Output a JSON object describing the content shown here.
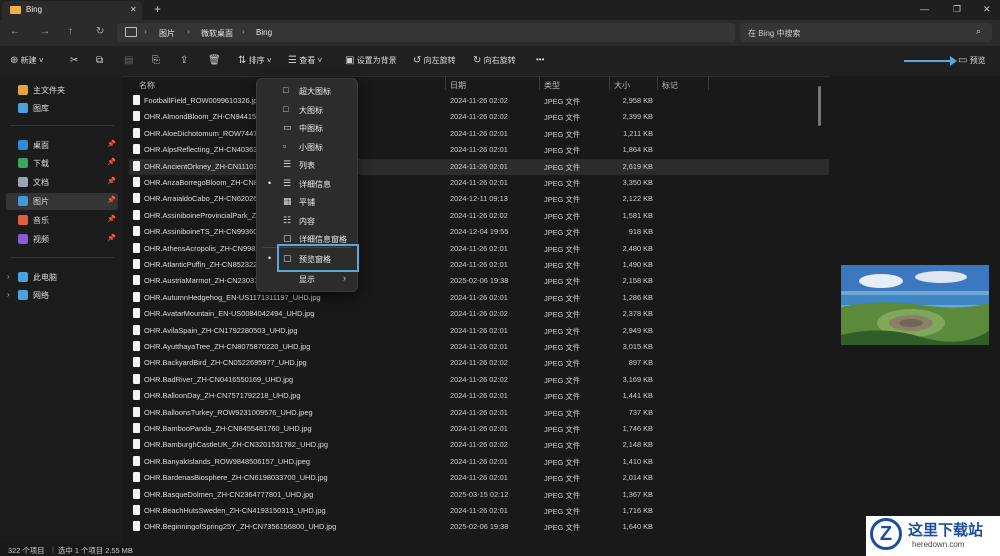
{
  "titlebar": {
    "tab_title": "Bing",
    "new_tab": "+",
    "min": "—",
    "max": "❐",
    "close": "✕"
  },
  "address": {
    "crumbs": [
      "图片",
      "微软桌面",
      "Bing"
    ],
    "search_placeholder": "在 Bing 中搜索"
  },
  "toolbar": {
    "new_label": "新建",
    "sort_label": "排序",
    "view_label": "查看",
    "set_bg_label": "设置为背景",
    "rotate_left_label": "向左旋转",
    "rotate_right_label": "向右旋转",
    "more_label": "•••",
    "preview_label": "预览"
  },
  "sidebar": {
    "items": [
      {
        "label": "主文件夹",
        "color": "#e8a33d"
      },
      {
        "label": "图库",
        "color": "#4aa3df"
      },
      {
        "label": "桌面",
        "color": "#2f88d8",
        "pin": "📌"
      },
      {
        "label": "下载",
        "color": "#3aa55d",
        "pin": "📌"
      },
      {
        "label": "文档",
        "color": "#9aa4b1",
        "pin": "📌"
      },
      {
        "label": "图片",
        "color": "#3e9ad8",
        "pin": "📌"
      },
      {
        "label": "音乐",
        "color": "#e0603a",
        "pin": "📌"
      },
      {
        "label": "视频",
        "color": "#8a5ad8",
        "pin": "📌"
      },
      {
        "label": "此电脑",
        "color": "#4aa3df"
      },
      {
        "label": "网络",
        "color": "#4aa3df"
      }
    ]
  },
  "columns": {
    "name": "名称",
    "date": "日期",
    "type": "类型",
    "size": "大小",
    "tag": "标记"
  },
  "files": [
    {
      "name": "FootballField_ROW0099610326.jpg",
      "date": "2024-11-26 02:02",
      "type": "JPEG 文件",
      "size": "2,958 KB"
    },
    {
      "name": "OHR.AlmondBloom_ZH-CN9441554",
      "date": "2024-11-26 02:02",
      "type": "JPEG 文件",
      "size": "2,399 KB"
    },
    {
      "name": "OHR.AloeDichotomum_ROW7447",
      "date": "2024-11-26 02:01",
      "type": "JPEG 文件",
      "size": "1,211 KB"
    },
    {
      "name": "OHR.AlpsReflecting_ZH-CN403632",
      "date": "2024-11-26 02:01",
      "type": "JPEG 文件",
      "size": "1,864 KB"
    },
    {
      "name": "OHR.AncientOrkney_ZH-CN11103",
      "date": "2024-11-26 02:01",
      "type": "JPEG 文件",
      "size": "2,619 KB"
    },
    {
      "name": "OHR.AnzaBorregoBloom_ZH-CN8",
      "date": "2024-11-26 02:01",
      "type": "JPEG 文件",
      "size": "3,350 KB"
    },
    {
      "name": "OHR.ArraialdoCabo_ZH-CN62026",
      "date": "2024-12-11 09:13",
      "type": "JPEG 文件",
      "size": "2,122 KB"
    },
    {
      "name": "OHR.AssiniboineProvincialPark_ZH",
      "date": "2024-11-26 02:02",
      "type": "JPEG 文件",
      "size": "1,581 KB"
    },
    {
      "name": "OHR.AssiniboineTS_ZH-CN993604",
      "date": "2024-12-04 19:55",
      "type": "JPEG 文件",
      "size": "918 KB"
    },
    {
      "name": "OHR.AthensAcropolis_ZH-CN9982",
      "date": "2024-11-26 02:01",
      "type": "JPEG 文件",
      "size": "2,480 KB"
    },
    {
      "name": "OHR.AtlanticPuffin_ZH-CN852322",
      "date": "2024-11-26 02:01",
      "type": "JPEG 文件",
      "size": "1,490 KB"
    },
    {
      "name": "OHR.AustriaMarmot_ZH-CN23037",
      "date": "2025-02-06 19:38",
      "type": "JPEG 文件",
      "size": "2,158 KB"
    },
    {
      "name": "OHR.AutumnHedgehog_EN-US1171311197_UHD.jpg",
      "date": "2024-11-26 02:01",
      "type": "JPEG 文件",
      "size": "1,286 KB"
    },
    {
      "name": "OHR.AvatarMountain_EN-US0084042494_UHD.jpg",
      "date": "2024-11-26 02:02",
      "type": "JPEG 文件",
      "size": "2,378 KB"
    },
    {
      "name": "OHR.AvilaSpain_ZH-CN1792280503_UHD.jpg",
      "date": "2024-11-26 02:01",
      "type": "JPEG 文件",
      "size": "2,949 KB"
    },
    {
      "name": "OHR.AyutthayaTree_ZH-CN8075870220_UHD.jpg",
      "date": "2024-11-26 02:01",
      "type": "JPEG 文件",
      "size": "3,015 KB"
    },
    {
      "name": "OHR.BackyardBird_ZH-CN0522695977_UHD.jpg",
      "date": "2024-11-26 02:02",
      "type": "JPEG 文件",
      "size": "897 KB"
    },
    {
      "name": "OHR.BadRiver_ZH-CN0416550169_UHD.jpg",
      "date": "2024-11-26 02:02",
      "type": "JPEG 文件",
      "size": "3,169 KB"
    },
    {
      "name": "OHR.BalloonDay_ZH-CN7571792218_UHD.jpg",
      "date": "2024-11-26 02:01",
      "type": "JPEG 文件",
      "size": "1,441 KB"
    },
    {
      "name": "OHR.BalloonsTurkey_ROW9231009576_UHD.jpeg",
      "date": "2024-11-26 02:01",
      "type": "JPEG 文件",
      "size": "737 KB"
    },
    {
      "name": "OHR.BambooPanda_ZH-CN8455481760_UHD.jpg",
      "date": "2024-11-26 02:01",
      "type": "JPEG 文件",
      "size": "1,746 KB"
    },
    {
      "name": "OHR.BamburghCastleUK_ZH-CN3201531782_UHD.jpg",
      "date": "2024-11-26 02:02",
      "type": "JPEG 文件",
      "size": "2,148 KB"
    },
    {
      "name": "OHR.BanyakIslands_ROW9848506157_UHD.jpeg",
      "date": "2024-11-26 02:01",
      "type": "JPEG 文件",
      "size": "1,410 KB"
    },
    {
      "name": "OHR.BardenasBiosphere_ZH-CN6198033700_UHD.jpg",
      "date": "2024-11-26 02:01",
      "type": "JPEG 文件",
      "size": "2,014 KB"
    },
    {
      "name": "OHR.BasqueDolmen_ZH-CN2364777801_UHD.jpg",
      "date": "2025-03-15 02:12",
      "type": "JPEG 文件",
      "size": "1,367 KB"
    },
    {
      "name": "OHR.BeachHutsSweden_ZH-CN4193150313_UHD.jpg",
      "date": "2024-11-26 02:01",
      "type": "JPEG 文件",
      "size": "1,716 KB"
    },
    {
      "name": "OHR.BeginningofSpring25Y_ZH-CN7356156800_UHD.jpg",
      "date": "2025-02-06 19:38",
      "type": "JPEG 文件",
      "size": "1,640 KB"
    }
  ],
  "view_menu": {
    "items": [
      {
        "label": "超大图标",
        "icon": "□",
        "bullet": ""
      },
      {
        "label": "大图标",
        "icon": "□",
        "bullet": ""
      },
      {
        "label": "中图标",
        "icon": "▭",
        "bullet": ""
      },
      {
        "label": "小图标",
        "icon": "▫",
        "bullet": ""
      },
      {
        "label": "列表",
        "icon": "☰",
        "bullet": ""
      },
      {
        "label": "详细信息",
        "icon": "☰",
        "bullet": "•"
      },
      {
        "label": "平铺",
        "icon": "▦",
        "bullet": ""
      },
      {
        "label": "内容",
        "icon": "☷",
        "bullet": ""
      },
      {
        "label": "详细信息窗格",
        "icon": "▢",
        "bullet": ""
      },
      {
        "label": "预览窗格",
        "icon": "▢",
        "bullet": "•"
      },
      {
        "label": "显示",
        "icon": "",
        "bullet": "",
        "chevron": "›"
      }
    ]
  },
  "status": {
    "count": "322 个项目",
    "selection": "选中 1 个项目  2.55 MB"
  },
  "watermark": {
    "line1": "这里下载站",
    "line2": "heredown.com",
    "logo": "Z"
  }
}
